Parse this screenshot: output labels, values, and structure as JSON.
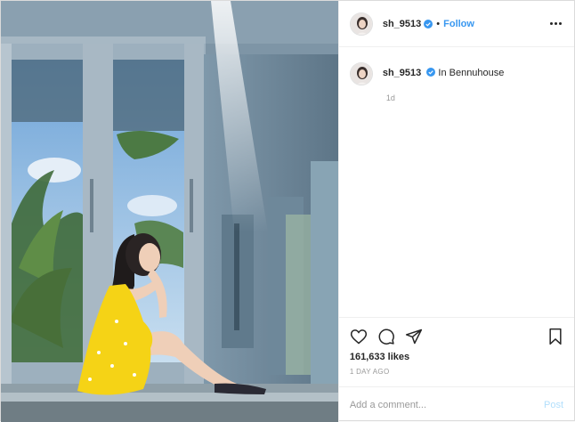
{
  "post": {
    "username": "sh_9513",
    "follow_label": "Follow",
    "location": "In Bennuhouse",
    "relative_time": "1d",
    "likes": "161,633 likes",
    "posted_ago": "1 DAY AGO",
    "comment_placeholder": "Add a comment...",
    "post_label": "Post"
  },
  "icons": [
    "verified-badge-icon",
    "more-options-icon",
    "heart-icon",
    "comment-icon",
    "share-icon",
    "bookmark-icon"
  ],
  "colors": {
    "link_blue": "#3897f0",
    "verified_blue": "#3897f0",
    "dress_yellow": "#f5d316",
    "muted_text": "#999999"
  }
}
